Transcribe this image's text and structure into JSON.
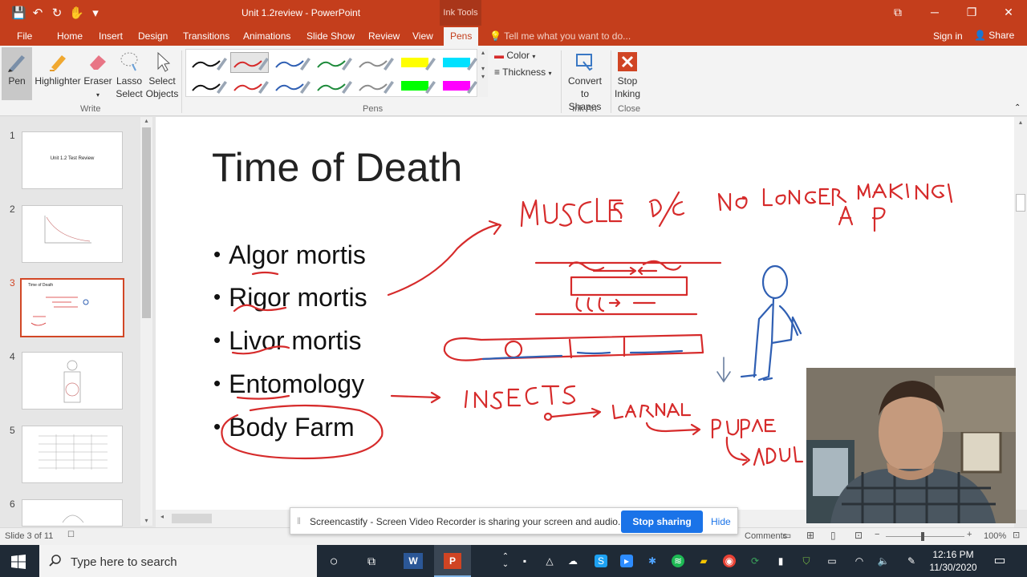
{
  "window": {
    "title": "Unit 1.2review - PowerPoint",
    "context_tab": "Ink Tools",
    "qat": {
      "save": "save-icon",
      "undo": "undo-icon",
      "redo": "redo-icon",
      "customize": "customize-icon"
    },
    "minimize": "─",
    "restore": "❐",
    "close": "✕",
    "ribbon_display": "⧉"
  },
  "tabs": {
    "file": "File",
    "home": "Home",
    "insert": "Insert",
    "design": "Design",
    "transitions": "Transitions",
    "animations": "Animations",
    "slideshow": "Slide Show",
    "review": "Review",
    "view": "View",
    "pens": "Pens",
    "tellme": "Tell me what you want to do...",
    "signin": "Sign in",
    "share": "Share"
  },
  "ribbon": {
    "write": {
      "label": "Write",
      "pen": "Pen",
      "highlighter": "Highlighter",
      "eraser": "Eraser",
      "lasso": "Lasso Select",
      "select_objects": "Select Objects"
    },
    "pens": {
      "label": "Pens",
      "color": "Color",
      "thickness": "Thickness"
    },
    "pen_colors": [
      "#111111",
      "#d62b2b",
      "#2f5fb3",
      "#1d8a3a",
      "#8c8c8c",
      "#ffff00",
      "#00e1ff",
      "#111111",
      "#d62b2b",
      "#2f5fb3",
      "#1d8a3a",
      "#8c8c8c",
      "#00ff00",
      "#ff00ff"
    ],
    "ink_art": {
      "label": "Ink Art",
      "convert": "Convert to Shapes"
    },
    "close": {
      "label": "Close",
      "stop": "Stop Inking"
    }
  },
  "slides": {
    "numbers": [
      "1",
      "2",
      "3",
      "4",
      "5",
      "6"
    ],
    "thumb1_title": "Unit 1.2 Test Review",
    "thumb3_title": "Time of Death"
  },
  "slide": {
    "title": "Time of Death",
    "bullets": [
      "Algor mortis",
      "Rigor mortis",
      "Livor mortis",
      "Entomology",
      "Body Farm"
    ],
    "bullet_char": "•"
  },
  "status": {
    "slide": "Slide 3 of 11",
    "comments": "Comments",
    "notes": "Notes",
    "zoom": "100%"
  },
  "notify": {
    "text": "Screencastify - Screen Video Recorder is sharing your screen and audio.",
    "stop": "Stop sharing",
    "hide": "Hide"
  },
  "taskbar": {
    "search": "Type here to search",
    "time": "12:16 PM",
    "date": "11/30/2020"
  },
  "colors": {
    "accent": "#c43e1c",
    "ink_red": "#d62b2b",
    "ink_blue": "#2f5fb3"
  }
}
